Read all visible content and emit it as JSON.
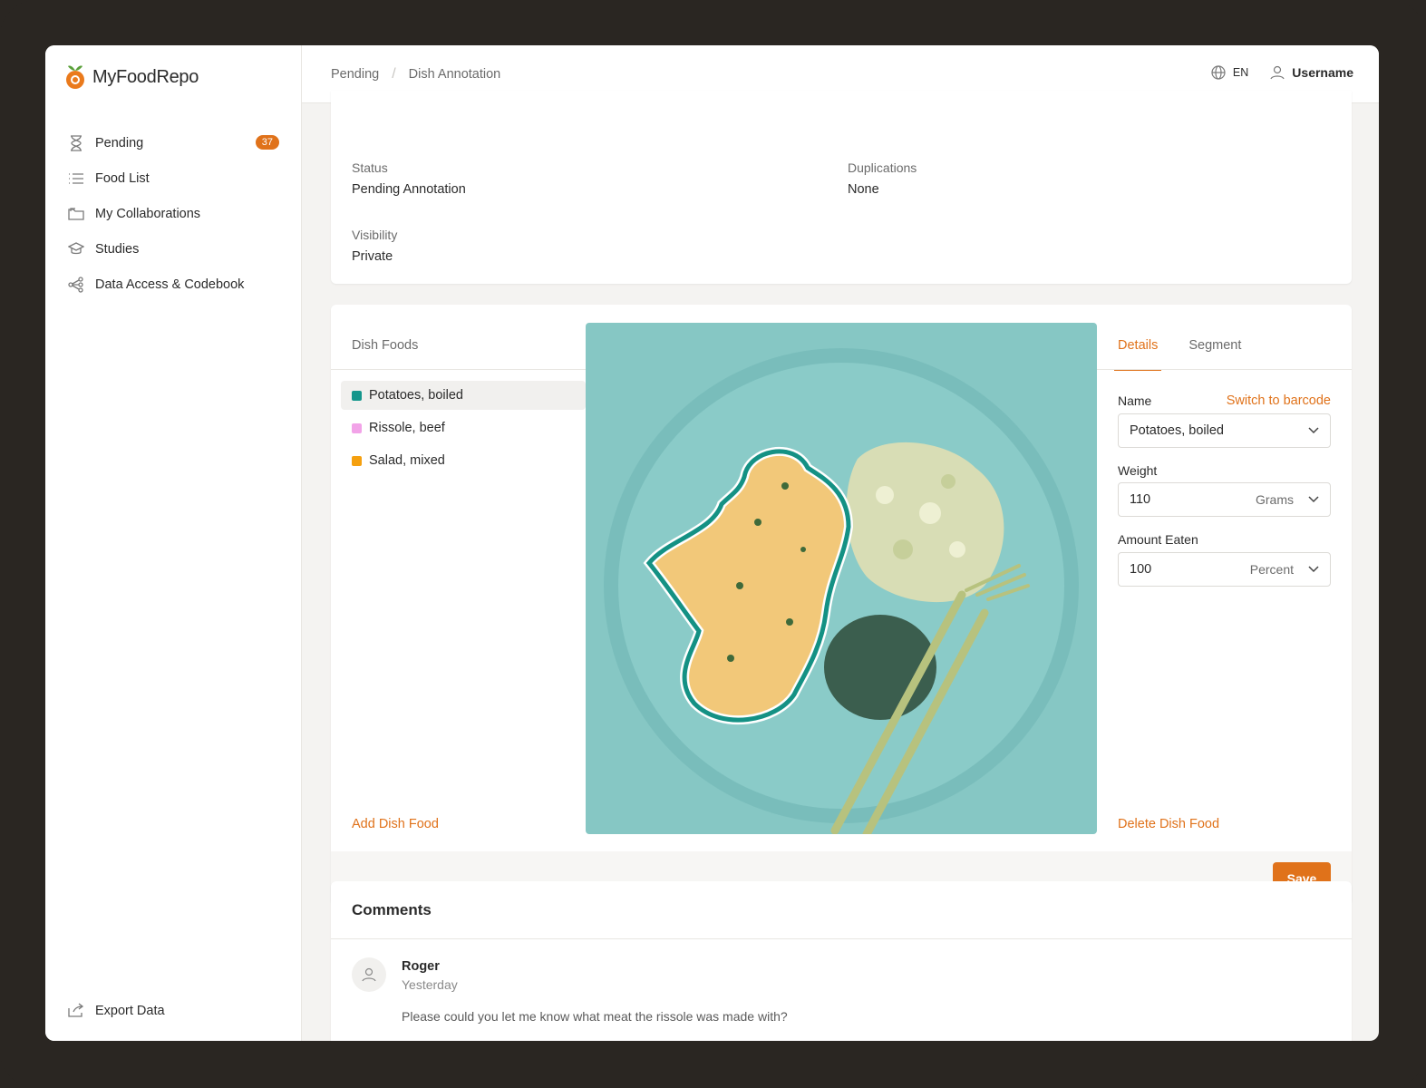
{
  "app": {
    "name": "MyFoodRepo",
    "brand_color": "#e0721a"
  },
  "sidebar": {
    "items": [
      {
        "label": "Pending",
        "icon": "hourglass-icon",
        "badge": "37"
      },
      {
        "label": "Food List",
        "icon": "list-icon"
      },
      {
        "label": "My Collaborations",
        "icon": "folder-icon"
      },
      {
        "label": "Studies",
        "icon": "graduation-cap-icon"
      },
      {
        "label": "Data Access & Codebook",
        "icon": "share-nodes-icon"
      }
    ],
    "export": {
      "label": "Export Data",
      "icon": "export-icon"
    }
  },
  "topbar": {
    "breadcrumb": [
      "Pending",
      "Dish Annotation"
    ],
    "language": "EN",
    "username": "Username"
  },
  "info": {
    "status_label": "Status",
    "status_value": "Pending Annotation",
    "duplications_label": "Duplications",
    "duplications_value": "None",
    "visibility_label": "Visibility",
    "visibility_value": "Private"
  },
  "dish_foods": {
    "title": "Dish Foods",
    "items": [
      {
        "label": "Potatoes, boiled",
        "color": "#14968c",
        "active": true
      },
      {
        "label": "Rissole, beef",
        "color": "#f2a3e8",
        "active": false
      },
      {
        "label": "Salad, mixed",
        "color": "#f5a00f",
        "active": false
      }
    ],
    "add_label": "Add Dish Food"
  },
  "details": {
    "tabs": [
      "Details",
      "Segment"
    ],
    "name_label": "Name",
    "switch_label": "Switch to barcode",
    "name_value": "Potatoes, boiled",
    "weight_label": "Weight",
    "weight_value": "110",
    "weight_unit": "Grams",
    "amount_label": "Amount Eaten",
    "amount_value": "100",
    "amount_unit": "Percent",
    "delete_label": "Delete Dish Food",
    "save_label": "Save"
  },
  "comments": {
    "title": "Comments",
    "items": [
      {
        "author": "Roger",
        "time": "Yesterday",
        "text": "Please could you let me know what meat the rissole was made with?"
      }
    ]
  }
}
